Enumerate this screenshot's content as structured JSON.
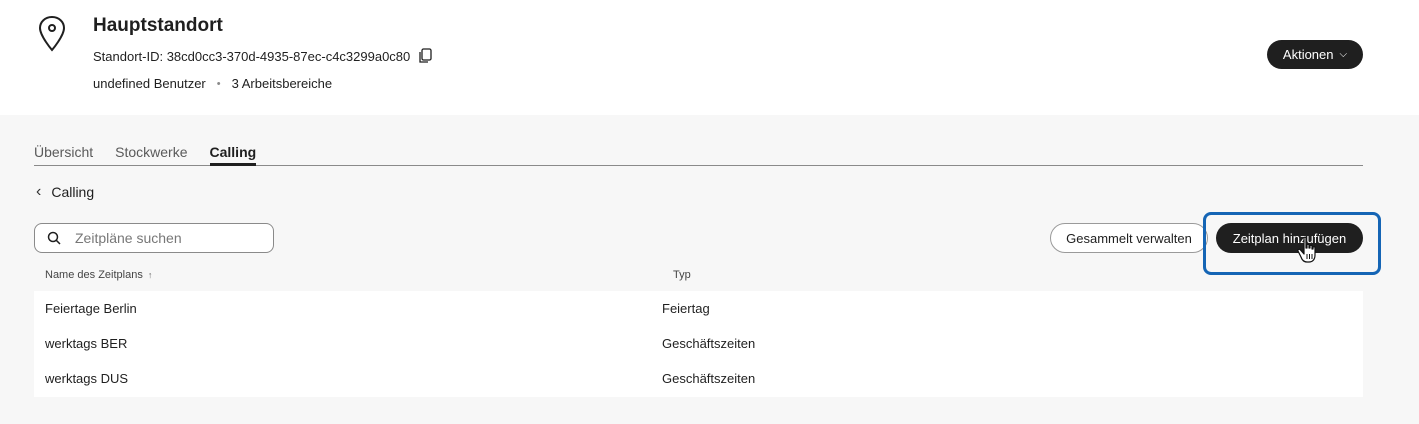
{
  "header": {
    "title": "Hauptstandort",
    "id_line": "Standort-ID: 38cd0cc3-370d-4935-87ec-c4c3299a0c80",
    "users": "undefined Benutzer",
    "separator": "•",
    "workspaces": "3 Arbeitsbereiche",
    "actions_label": "Aktionen",
    "actions_chevron": "⌵"
  },
  "tabs": [
    {
      "label": "Übersicht",
      "active": false
    },
    {
      "label": "Stockwerke",
      "active": false
    },
    {
      "label": "Calling",
      "active": true
    }
  ],
  "back": {
    "label": "Calling",
    "chevron": "‹"
  },
  "toolbar": {
    "search_placeholder": "Zeitpläne suchen",
    "bulk_label": "Gesammelt verwalten",
    "add_label": "Zeitplan hinzufügen"
  },
  "table": {
    "col_name": "Name des Zeitplans",
    "sort_arrow": "↑",
    "col_type": "Typ",
    "rows": [
      {
        "name": "Feiertage Berlin",
        "type": "Feiertag"
      },
      {
        "name": "werktags BER",
        "type": "Geschäftszeiten"
      },
      {
        "name": "werktags DUS",
        "type": "Geschäftszeiten"
      }
    ]
  },
  "icons": {
    "location": "location-pin-icon",
    "copy": "copy-icon",
    "search": "search-icon",
    "cursor": "hand-pointer-cursor-icon"
  },
  "colors": {
    "primary_button": "#1f1f1f",
    "highlight": "#1565b5",
    "page_background": "#f7f7f7"
  }
}
